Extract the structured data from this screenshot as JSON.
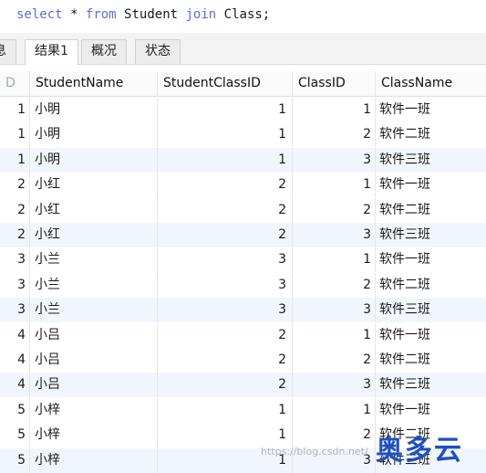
{
  "query": {
    "kw_select": "select",
    "star": "*",
    "kw_from": "from",
    "table1": "Student",
    "kw_join": "join",
    "table2": "Class;"
  },
  "tabs": [
    {
      "label": "息"
    },
    {
      "label": "结果1"
    },
    {
      "label": "概况"
    },
    {
      "label": "状态"
    }
  ],
  "table": {
    "columns": [
      "StudentName",
      "StudentClassID",
      "ClassID",
      "ClassName"
    ],
    "first_col_header": "D",
    "rows": [
      {
        "id": "1",
        "name": "小明",
        "scid": "1",
        "cid": "1",
        "cname": "软件一班"
      },
      {
        "id": "1",
        "name": "小明",
        "scid": "1",
        "cid": "2",
        "cname": "软件二班"
      },
      {
        "id": "1",
        "name": "小明",
        "scid": "1",
        "cid": "3",
        "cname": "软件三班"
      },
      {
        "id": "2",
        "name": "小红",
        "scid": "2",
        "cid": "1",
        "cname": "软件一班"
      },
      {
        "id": "2",
        "name": "小红",
        "scid": "2",
        "cid": "2",
        "cname": "软件二班"
      },
      {
        "id": "2",
        "name": "小红",
        "scid": "2",
        "cid": "3",
        "cname": "软件三班"
      },
      {
        "id": "3",
        "name": "小兰",
        "scid": "3",
        "cid": "1",
        "cname": "软件一班"
      },
      {
        "id": "3",
        "name": "小兰",
        "scid": "3",
        "cid": "2",
        "cname": "软件二班"
      },
      {
        "id": "3",
        "name": "小兰",
        "scid": "3",
        "cid": "3",
        "cname": "软件三班"
      },
      {
        "id": "4",
        "name": "小吕",
        "scid": "2",
        "cid": "1",
        "cname": "软件一班"
      },
      {
        "id": "4",
        "name": "小吕",
        "scid": "2",
        "cid": "2",
        "cname": "软件二班"
      },
      {
        "id": "4",
        "name": "小吕",
        "scid": "2",
        "cid": "3",
        "cname": "软件三班"
      },
      {
        "id": "5",
        "name": "小梓",
        "scid": "1",
        "cid": "1",
        "cname": "软件一班"
      },
      {
        "id": "5",
        "name": "小梓",
        "scid": "1",
        "cid": "2",
        "cname": "软件二班"
      },
      {
        "id": "5",
        "name": "小梓",
        "scid": "1",
        "cid": "3",
        "cname": "软件三班"
      }
    ]
  },
  "watermark": "https://blog.csdn.net/",
  "logo_text": "奥多云"
}
